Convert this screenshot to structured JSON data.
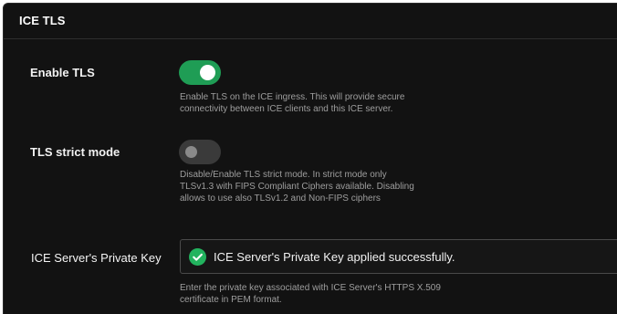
{
  "panel": {
    "title": "ICE TLS"
  },
  "enable_tls": {
    "label": "Enable TLS",
    "enabled": true,
    "description": "Enable TLS on the ICE ingress. This will provide secure connectivity between ICE clients and this ICE server."
  },
  "strict_mode": {
    "label": "TLS strict mode",
    "enabled": false,
    "description": "Disable/Enable TLS strict mode. In strict mode only TLSv1.3 with FIPS Compliant Ciphers available. Disabling allows to use also TLSv1.2 and Non-FIPS ciphers"
  },
  "private_key": {
    "label": "ICE Server's Private Key",
    "status_text": "ICE Server's Private Key applied successfully.",
    "status_icon": "check-circle-icon",
    "description": "Enter the private key associated with ICE Server's HTTPS X.509 certificate in PEM format."
  },
  "colors": {
    "background": "#121212",
    "toggle_on": "#1f9d55",
    "toggle_off": "#3a3a3a",
    "success": "#22b35e",
    "description_text": "#9e9e9e"
  }
}
